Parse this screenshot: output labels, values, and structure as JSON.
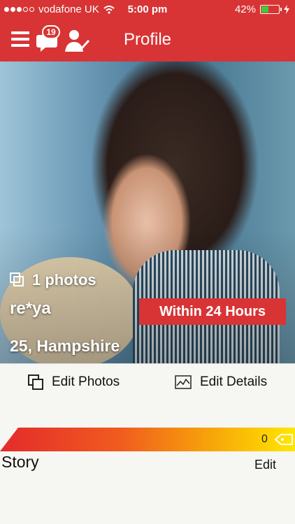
{
  "status_bar": {
    "carrier": "vodafone UK",
    "time": "5:00 pm",
    "battery": "42%",
    "battery_level": 0.42
  },
  "nav": {
    "title": "Profile",
    "messages_badge": "19",
    "icons": [
      "menu-icon",
      "chat-icon",
      "user-check-icon"
    ]
  },
  "profile": {
    "photos_count": "1 photos",
    "name": "re*ya",
    "age_location": "25, Hampshire",
    "activity_badge": "Within 24 Hours"
  },
  "actions": {
    "edit_photos": "Edit Photos",
    "edit_details": "Edit Details"
  },
  "score": {
    "value": "0"
  },
  "story": {
    "heading": "Story",
    "edit_label": "Edit"
  },
  "colors": {
    "accent": "#d83435",
    "battery_green": "#3ecb3e"
  }
}
